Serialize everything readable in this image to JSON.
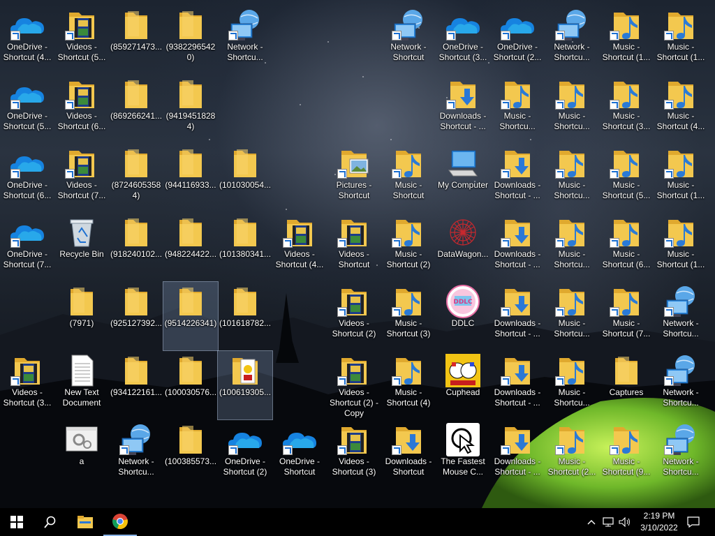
{
  "desktop_icons": [
    {
      "label": "OneDrive - Shortcut (4...",
      "type": "onedrive"
    },
    {
      "label": "Videos - Shortcut (5...",
      "type": "videos"
    },
    {
      "label": "(859271473...",
      "type": "folder"
    },
    {
      "label": "(93822965420)",
      "type": "folder"
    },
    {
      "label": "Network - Shortcu...",
      "type": "network"
    },
    {
      "label": "Network - Shortcut",
      "type": "network"
    },
    {
      "label": "OneDrive - Shortcut (3...",
      "type": "onedrive"
    },
    {
      "label": "OneDrive - Shortcut (2...",
      "type": "onedrive"
    },
    {
      "label": "Network - Shortcu...",
      "type": "network"
    },
    {
      "label": "Music - Shortcut (1...",
      "type": "music"
    },
    {
      "label": "Music - Shortcut (1...",
      "type": "music"
    },
    {
      "label": "OneDrive - Shortcut (5...",
      "type": "onedrive"
    },
    {
      "label": "Videos - Shortcut (6...",
      "type": "videos"
    },
    {
      "label": "(869266241...",
      "type": "folder"
    },
    {
      "label": "(94194518284)",
      "type": "folder"
    },
    {
      "label": "Downloads - Shortcut - ...",
      "type": "downloads"
    },
    {
      "label": "Music - Shortcu...",
      "type": "music"
    },
    {
      "label": "Music - Shortcu...",
      "type": "music"
    },
    {
      "label": "Music - Shortcut (3...",
      "type": "music"
    },
    {
      "label": "Music - Shortcut (4...",
      "type": "music"
    },
    {
      "label": "OneDrive - Shortcut (6...",
      "type": "onedrive"
    },
    {
      "label": "Videos - Shortcut (7...",
      "type": "videos"
    },
    {
      "label": "(87246053584)",
      "type": "folder"
    },
    {
      "label": "(944116933...",
      "type": "folder"
    },
    {
      "label": "(101030054...",
      "type": "folder"
    },
    {
      "label": "Pictures - Shortcut",
      "type": "pictures"
    },
    {
      "label": "Music - Shortcut",
      "type": "music"
    },
    {
      "label": "My Computer",
      "type": "computer"
    },
    {
      "label": "Downloads - Shortcut - ...",
      "type": "downloads"
    },
    {
      "label": "Music - Shortcu...",
      "type": "music"
    },
    {
      "label": "Music - Shortcut (5...",
      "type": "music"
    },
    {
      "label": "Music - Shortcut (1...",
      "type": "music"
    },
    {
      "label": "OneDrive - Shortcut (7...",
      "type": "onedrive"
    },
    {
      "label": "Recycle Bin",
      "type": "recycle"
    },
    {
      "label": "(918240102...",
      "type": "folder"
    },
    {
      "label": "(948224422...",
      "type": "folder"
    },
    {
      "label": "(101380341...",
      "type": "folder"
    },
    {
      "label": "Videos - Shortcut (4...",
      "type": "videos"
    },
    {
      "label": "Videos - Shortcut",
      "type": "videos"
    },
    {
      "label": "Music - Shortcut (2)",
      "type": "music"
    },
    {
      "label": "DataWagon...",
      "type": "datawagon"
    },
    {
      "label": "Downloads - Shortcut - ...",
      "type": "downloads"
    },
    {
      "label": "Music - Shortcu...",
      "type": "music"
    },
    {
      "label": "Music - Shortcut (6...",
      "type": "music"
    },
    {
      "label": "Music - Shortcut (1...",
      "type": "music"
    },
    {
      "label": "(7971)",
      "type": "folder"
    },
    {
      "label": "(925127392...",
      "type": "folder"
    },
    {
      "label": "(9514226341)",
      "type": "folder"
    },
    {
      "label": "(101618782...",
      "type": "folder"
    },
    {
      "label": "Videos - Shortcut (2)",
      "type": "videos"
    },
    {
      "label": "Music - Shortcut (3)",
      "type": "music"
    },
    {
      "label": "DDLC",
      "type": "ddlc"
    },
    {
      "label": "Downloads - Shortcut - ...",
      "type": "downloads"
    },
    {
      "label": "Music - Shortcu...",
      "type": "music"
    },
    {
      "label": "Music - Shortcut (7...",
      "type": "music"
    },
    {
      "label": "Network - Shortcu...",
      "type": "network"
    },
    {
      "label": "Videos - Shortcut (3...",
      "type": "videos"
    },
    {
      "label": "New Text Document",
      "type": "textdoc"
    },
    {
      "label": "(934122161...",
      "type": "folder"
    },
    {
      "label": "(100030576...",
      "type": "folder"
    },
    {
      "label": "(100619305...",
      "type": "folderimg"
    },
    {
      "label": "Videos - Shortcut (2) - Copy",
      "type": "videos"
    },
    {
      "label": "Music - Shortcut (4)",
      "type": "music"
    },
    {
      "label": "Cuphead",
      "type": "cuphead"
    },
    {
      "label": "Downloads - Shortcut - ...",
      "type": "downloads"
    },
    {
      "label": "Music - Shortcu...",
      "type": "music"
    },
    {
      "label": "Captures",
      "type": "folder"
    },
    {
      "label": "Network - Shortcu...",
      "type": "network"
    },
    {
      "label": "a",
      "type": "settings"
    },
    {
      "label": "Network - Shortcu...",
      "type": "network"
    },
    {
      "label": "(100385573...",
      "type": "folder"
    },
    {
      "label": "OneDrive - Shortcut (2)",
      "type": "onedrive"
    },
    {
      "label": "OneDrive - Shortcut",
      "type": "onedrive"
    },
    {
      "label": "Videos - Shortcut (3)",
      "type": "videos"
    },
    {
      "label": "Downloads - Shortcut",
      "type": "downloads"
    },
    {
      "label": "The Fastest Mouse C...",
      "type": "mouse"
    },
    {
      "label": "Downloads - Shortcut - ...",
      "type": "downloads"
    },
    {
      "label": "Music - Shortcut (2...",
      "type": "music"
    },
    {
      "label": "Music - Shortcut (9...",
      "type": "music"
    },
    {
      "label": "Network - Shortcu...",
      "type": "network"
    }
  ],
  "taskbar": {
    "time": "2:19 PM",
    "date": "3/10/2022"
  },
  "colors": {
    "taskbar": "#000000",
    "accent": "#1b6fd1",
    "folder": "#f3c84f"
  }
}
